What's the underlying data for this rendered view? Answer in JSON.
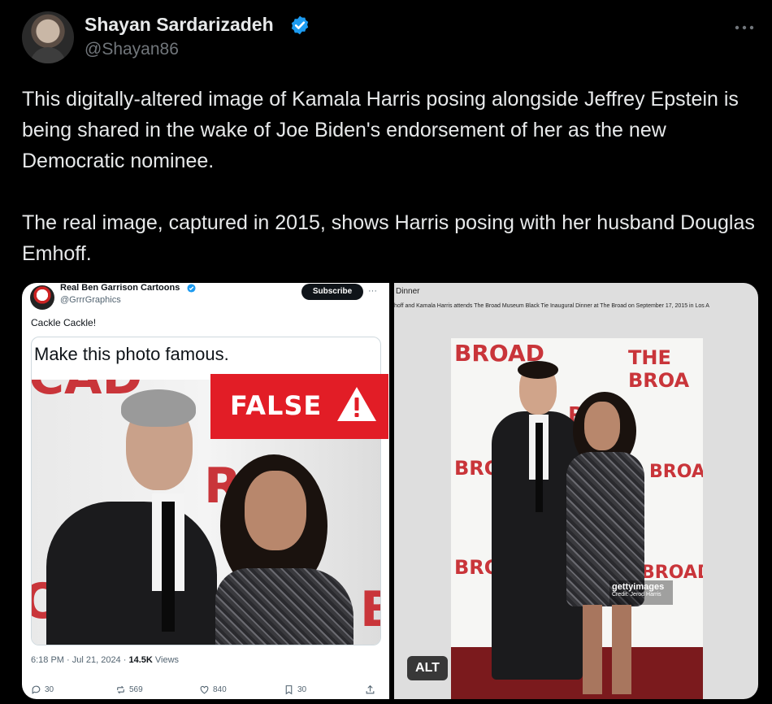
{
  "author": {
    "display_name": "Shayan Sardarizadeh",
    "handle": "@Shayan86",
    "verified_icon": "verified-badge-icon"
  },
  "tweet": {
    "text": "This digitally-altered image of Kamala Harris posing alongside Jeffrey Epstein is being shared in the wake of Joe Biden's endorsement of her as the new Democratic nominee.\n\nThe real image, captured in 2015, shows Harris posing with her husband Douglas Emhoff."
  },
  "media": {
    "left": {
      "name": "Real Ben Garrison Cartoons",
      "handle": "@GrrrGraphics",
      "subscribe_label": "Subscribe",
      "more_glyph": "···",
      "body": "Cackle Cackle!",
      "quote_text": "Make this photo famous.",
      "false_label": "FALSE",
      "bg_text_1": "CAD",
      "bg_text_2": "R",
      "bg_text_3": "O",
      "bg_text_4": "B",
      "timestamp": "6:18 PM · Jul 21, 2024 · ",
      "views_count": "14.5K",
      "views_label": " Views",
      "replies": "30",
      "reposts": "569",
      "likes": "840",
      "bookmarks": "30"
    },
    "right": {
      "title": "Dinner",
      "caption": "hoff and Kamala Harris attends The Broad Museum Black Tie Inaugural Dinner at The Broad on September 17, 2015 in Los A",
      "bg_text_1": "BROAD",
      "bg_text_2": "THE BROA",
      "bg_text_3": "BRO",
      "bg_text_4": "BROAI",
      "bg_text_5": "BROA",
      "bg_text_6": "BROAD",
      "bg_text_7": "R",
      "getty_name": "gettyimages",
      "getty_credit": "Credit: Jerod Harris"
    },
    "alt_label": "ALT"
  },
  "colors": {
    "background": "#000000",
    "text": "#e7e9ea",
    "muted": "#71767b",
    "verified": "#1d9bf0",
    "false_red": "#e21d26",
    "broad_red": "#c9353a"
  }
}
